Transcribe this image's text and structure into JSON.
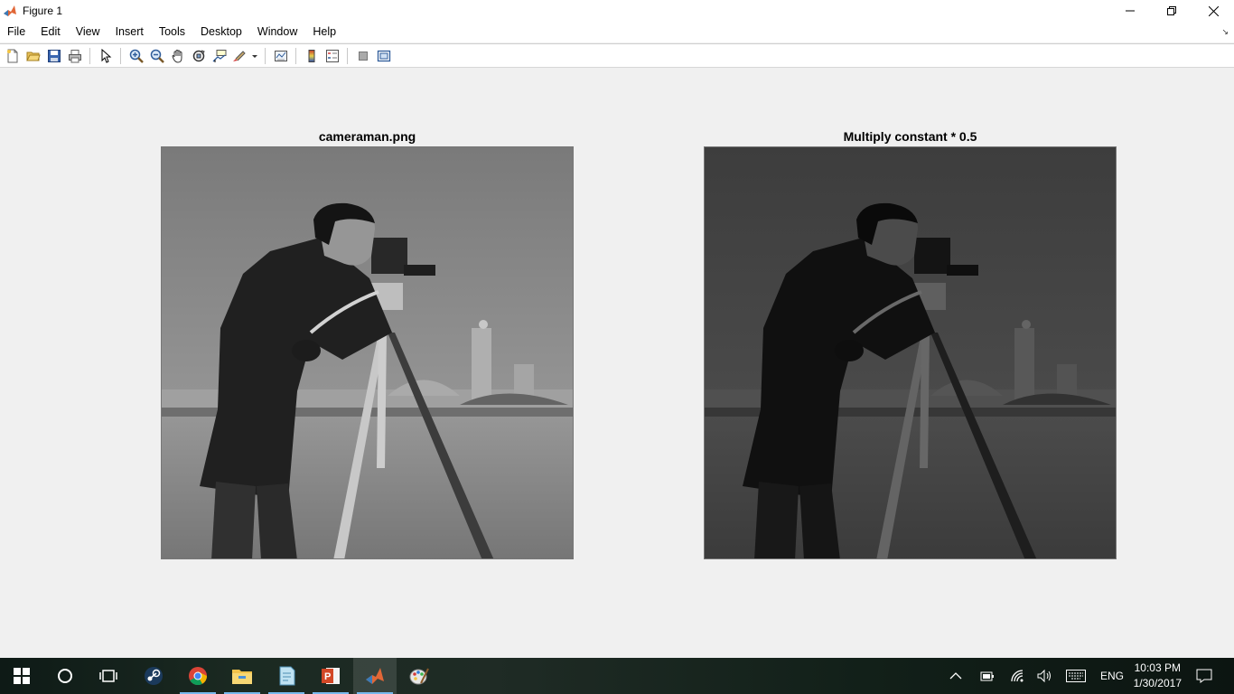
{
  "window": {
    "title": "Figure 1"
  },
  "menu": [
    "File",
    "Edit",
    "View",
    "Insert",
    "Tools",
    "Desktop",
    "Window",
    "Help"
  ],
  "toolbar": {
    "buttons": [
      "new-figure",
      "open-file",
      "save-figure",
      "print-figure",
      "edit-plot",
      "zoom-in",
      "zoom-out",
      "pan",
      "rotate-3d",
      "data-cursor",
      "brush",
      "link-plot",
      "insert-colorbar",
      "insert-legend",
      "hide-plot-tools",
      "show-plot-tools"
    ]
  },
  "axes": [
    {
      "title": "cameraman.png",
      "brightness": 1.0
    },
    {
      "title": "Multiply constant * 0.5",
      "brightness": 0.5
    }
  ],
  "taskbar": {
    "apps": [
      "start",
      "cortana",
      "task-view",
      "steam",
      "chrome",
      "file-explorer",
      "notepad",
      "powerpoint",
      "matlab",
      "paint"
    ],
    "language": "ENG",
    "time": "10:03 PM",
    "date": "1/30/2017"
  }
}
